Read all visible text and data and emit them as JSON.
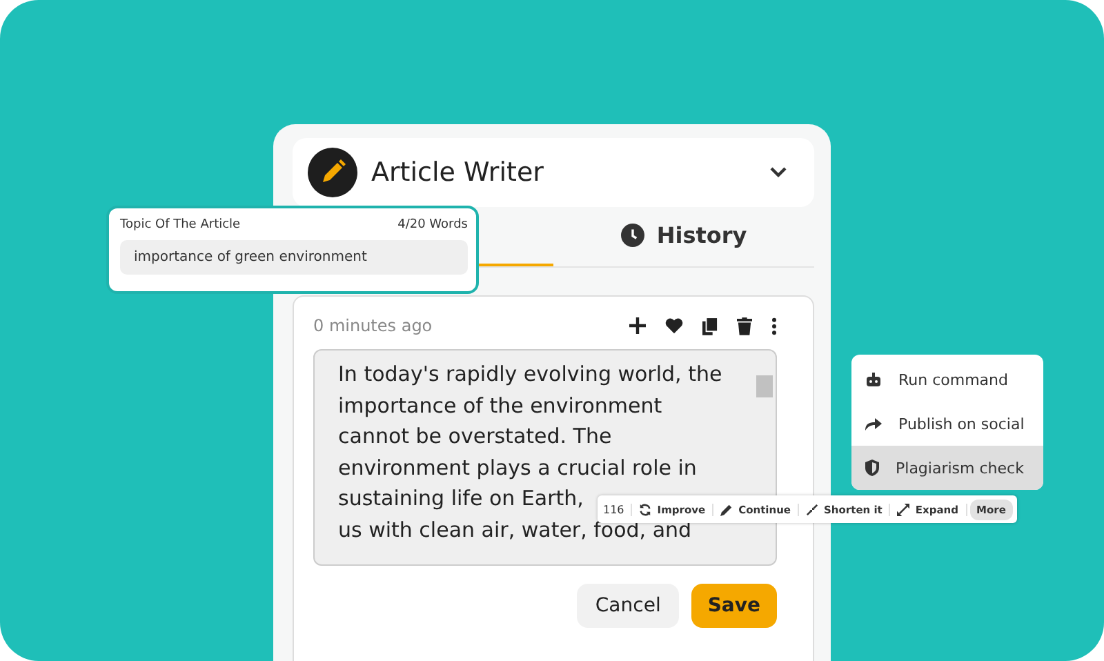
{
  "app": {
    "title": "Article Writer"
  },
  "tabs": [
    {
      "selected": true
    },
    {
      "label": "History",
      "selected": false
    }
  ],
  "topic": {
    "label": "Topic Of The Article",
    "count": "4/20 Words",
    "value": "importance of green environment"
  },
  "result": {
    "time": "0 minutes ago",
    "lines": [
      "In today's rapidly evolving world, the",
      "importance of the environment",
      "cannot be overstated. The",
      "environment plays a crucial role in",
      "sustaining life on Earth,",
      "us with clean air, water, food, and"
    ]
  },
  "toolbar": {
    "count": "116",
    "actions": [
      {
        "kind": "improve",
        "label": "Improve"
      },
      {
        "kind": "continue",
        "label": "Continue"
      },
      {
        "kind": "shorten",
        "label": "Shorten it"
      },
      {
        "kind": "expand",
        "label": "Expand"
      }
    ],
    "more": "More"
  },
  "menu": [
    {
      "kind": "robot",
      "label": "Run command",
      "selected": false
    },
    {
      "kind": "share",
      "label": "Publish on social",
      "selected": false
    },
    {
      "kind": "shield",
      "label": "Plagiarism check",
      "selected": true
    }
  ],
  "buttons": {
    "cancel": "Cancel",
    "save": "Save"
  }
}
